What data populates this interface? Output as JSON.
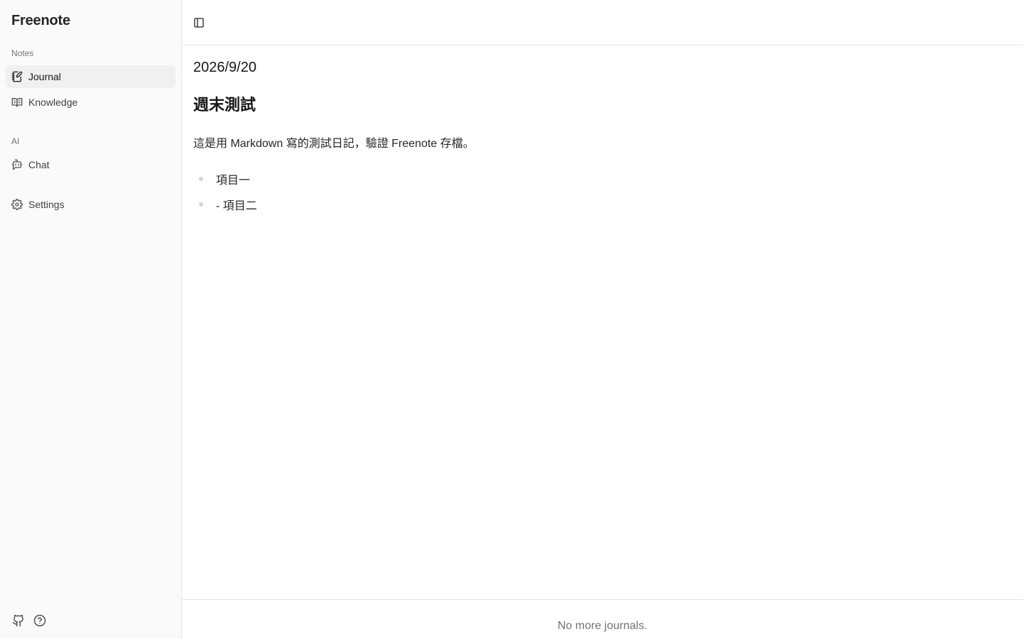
{
  "sidebar": {
    "brand": "Freenote",
    "groups": {
      "notes_label": "Notes",
      "ai_label": "AI"
    },
    "items": {
      "journal": "Journal",
      "knowledge": "Knowledge",
      "chat": "Chat",
      "settings": "Settings"
    },
    "active_item": "journal",
    "footer_icons": [
      "github-icon",
      "help-icon"
    ]
  },
  "topbar": {
    "toggle_icon": "sidebar-toggle-icon"
  },
  "journal": {
    "date": "2026/9/20",
    "title": "週末測試",
    "paragraph": "這是用 Markdown 寫的測試日記，驗證 Freenote 存檔。",
    "list": [
      "項目一",
      "- 項目二"
    ]
  },
  "footer": {
    "message": "No more journals."
  },
  "colors": {
    "sidebar_bg": "#fafafa",
    "active_item_bg": "#f0f0f0",
    "border": "#e5e5e5",
    "muted_text": "#737373"
  }
}
